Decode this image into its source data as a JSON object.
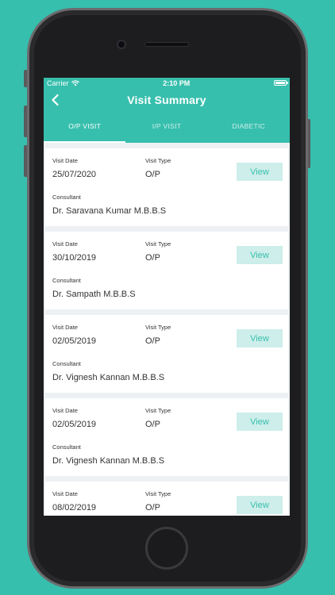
{
  "status_bar": {
    "carrier": "Carrier",
    "time": "2:10 PM"
  },
  "header": {
    "title": "Visit Summary"
  },
  "tabs": [
    {
      "label": "O/P VISIT",
      "active": true
    },
    {
      "label": "I/P VISIT",
      "active": false
    },
    {
      "label": "DIABETIC",
      "active": false
    }
  ],
  "labels": {
    "visit_date": "Visit Date",
    "visit_type": "Visit Type",
    "consultant": "Consultant",
    "view": "View"
  },
  "visits": [
    {
      "date": "25/07/2020",
      "type": "O/P",
      "consultant": "Dr. Saravana Kumar M.B.B.S"
    },
    {
      "date": "30/10/2019",
      "type": "O/P",
      "consultant": "Dr. Sampath M.B.B.S"
    },
    {
      "date": "02/05/2019",
      "type": "O/P",
      "consultant": "Dr. Vignesh Kannan M.B.B.S"
    },
    {
      "date": "02/05/2019",
      "type": "O/P",
      "consultant": "Dr. Vignesh Kannan M.B.B.S"
    },
    {
      "date": "08/02/2019",
      "type": "O/P",
      "consultant": ""
    }
  ],
  "colors": {
    "accent": "#37bfad",
    "button_bg": "#cdeeea",
    "screen_bg": "#eef1f4"
  }
}
